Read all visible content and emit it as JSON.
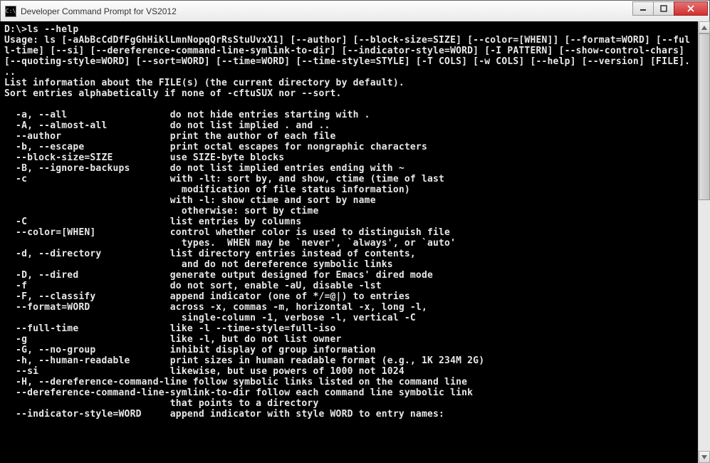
{
  "window": {
    "title": "Developer Command Prompt for VS2012",
    "icon_label": "C:\\"
  },
  "console": {
    "prompt": "D:\\>",
    "command": "ls --help",
    "usage_line1": "Usage: ls [-aAbBcCdDfFgGhHiklLmnNopqQrRsStuUvxX1] [--author] [--block-size=SIZE] [--color=[WHEN]] [--format=WORD] [--ful",
    "usage_line2": "l-time] [--si] [--dereference-command-line-symlink-to-dir] [--indicator-style=WORD] [-I PATTERN] [--show-control-chars]",
    "usage_line3": "[--quoting-style=WORD] [--sort=WORD] [--time=WORD] [--time-style=STYLE] [-T COLS] [-w COLS] [--help] [--version] [FILE].",
    "usage_line4": "..",
    "desc1": "List information about the FILE(s) (the current directory by default).",
    "desc2": "Sort entries alphabetically if none of -cftuSUX nor --sort.",
    "opts": [
      "  -a, --all                  do not hide entries starting with .",
      "  -A, --almost-all           do not list implied . and ..",
      "  --author                   print the author of each file",
      "  -b, --escape               print octal escapes for nongraphic characters",
      "  --block-size=SIZE          use SIZE-byte blocks",
      "  -B, --ignore-backups       do not list implied entries ending with ~",
      "  -c                         with -lt: sort by, and show, ctime (time of last",
      "                               modification of file status information)",
      "                             with -l: show ctime and sort by name",
      "                               otherwise: sort by ctime",
      "  -C                         list entries by columns",
      "  --color=[WHEN]             control whether color is used to distinguish file",
      "                               types.  WHEN may be `never', `always', or `auto'",
      "  -d, --directory            list directory entries instead of contents,",
      "                               and do not dereference symbolic links",
      "  -D, --dired                generate output designed for Emacs' dired mode",
      "  -f                         do not sort, enable -aU, disable -lst",
      "  -F, --classify             append indicator (one of */=@|) to entries",
      "  --format=WORD              across -x, commas -m, horizontal -x, long -l,",
      "                               single-column -1, verbose -l, vertical -C",
      "  --full-time                like -l --time-style=full-iso",
      "  -g                         like -l, but do not list owner",
      "  -G, --no-group             inhibit display of group information",
      "  -h, --human-readable       print sizes in human readable format (e.g., 1K 234M 2G)",
      "  --si                       likewise, but use powers of 1000 not 1024",
      "  -H, --dereference-command-line follow symbolic links listed on the command line",
      "  --dereference-command-line-symlink-to-dir follow each command line symbolic link",
      "                             that points to a directory",
      "  --indicator-style=WORD     append indicator with style WORD to entry names:"
    ]
  }
}
